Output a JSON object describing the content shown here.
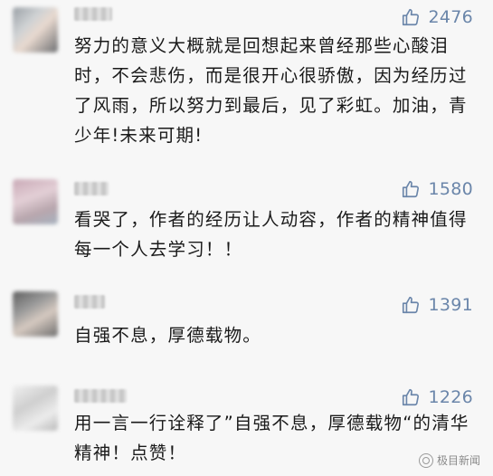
{
  "comments": [
    {
      "likes": "2476",
      "text": "努力的意义大概就是回想起来曾经那些心酸泪时，不会悲伤，而是很开心很骄傲，因为经历过了风雨，所以努力到最后，见了彩虹。加油，青少年!未来可期!"
    },
    {
      "likes": "1580",
      "text": "看哭了，作者的经历让人动容，作者的精神值得每一个人去学习！！"
    },
    {
      "likes": "1391",
      "text": "自强不息，厚德载物。"
    },
    {
      "likes": "1226",
      "text": "用一言一行诠释了”自强不息，厚德载物“的清华精神！点赞！"
    }
  ],
  "icons": {
    "like": "thumbs-up-icon",
    "watermark": "watermark-logo-icon"
  },
  "colors": {
    "like": "#6b86aa",
    "text": "#1a1a1a",
    "background": "#f7f7f7"
  },
  "watermark": {
    "text": "极目新闻"
  }
}
